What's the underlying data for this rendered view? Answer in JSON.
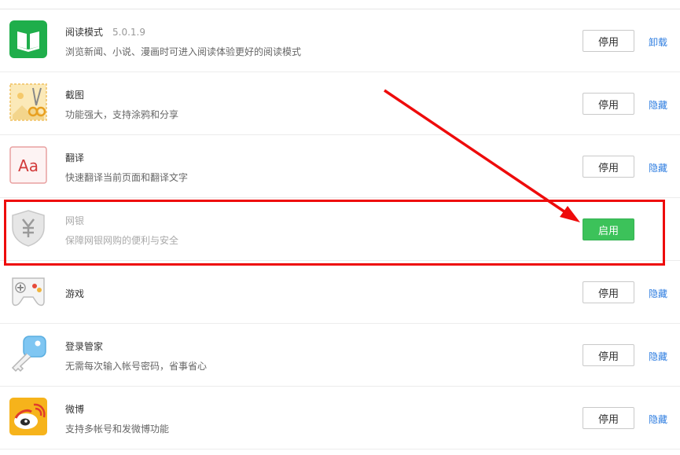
{
  "extensions": [
    {
      "name": "阅读模式",
      "version": "5.0.1.9",
      "desc": "浏览新闻、小说、漫画时可进入阅读体验更好的阅读模式",
      "button": "停用",
      "link": "卸载",
      "icon": "reading-mode-icon"
    },
    {
      "name": "截图",
      "version": "",
      "desc": "功能强大，支持涂鸦和分享",
      "button": "停用",
      "link": "隐藏",
      "icon": "screenshot-scissors-icon"
    },
    {
      "name": "翻译",
      "version": "",
      "desc": "快速翻译当前页面和翻译文字",
      "button": "停用",
      "link": "隐藏",
      "icon": "translate-icon"
    },
    {
      "name": "网银",
      "version": "",
      "desc": "保障网银网购的便利与安全",
      "button": "启用",
      "link": "",
      "icon": "bank-shield-icon"
    },
    {
      "name": "游戏",
      "version": "",
      "desc": "",
      "button": "停用",
      "link": "隐藏",
      "icon": "gamepad-icon"
    },
    {
      "name": "登录管家",
      "version": "",
      "desc": "无需每次输入帐号密码，省事省心",
      "button": "停用",
      "link": "隐藏",
      "icon": "key-icon"
    },
    {
      "name": "微博",
      "version": "",
      "desc": "支持多帐号和发微博功能",
      "button": "停用",
      "link": "隐藏",
      "icon": "weibo-icon"
    }
  ],
  "colors": {
    "enable_button": "#3cc25a",
    "link": "#2e7de0",
    "annotation": "#ee0b0b"
  }
}
